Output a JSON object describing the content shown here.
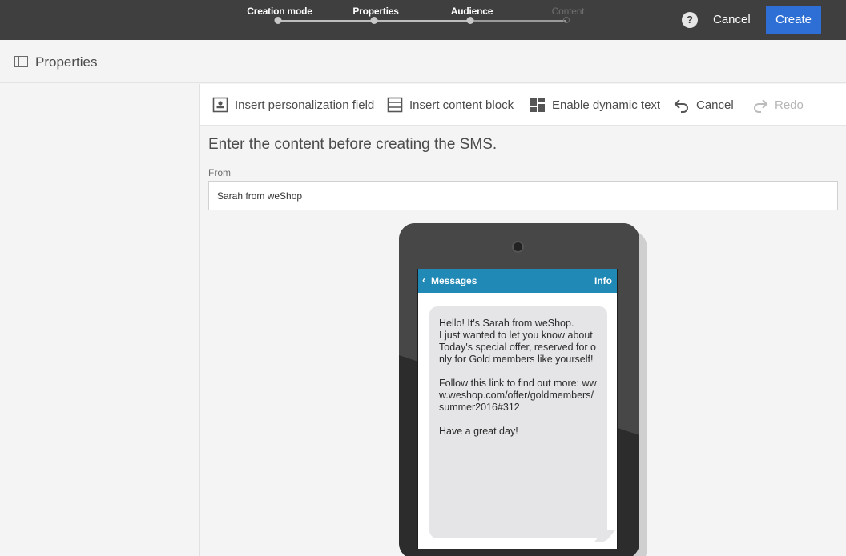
{
  "wizard": {
    "steps": [
      {
        "label": "Creation mode",
        "state": "done"
      },
      {
        "label": "Properties",
        "state": "done"
      },
      {
        "label": "Audience",
        "state": "done"
      },
      {
        "label": "Content",
        "state": "current"
      }
    ],
    "help_icon": "?",
    "cancel_label": "Cancel",
    "create_label": "Create"
  },
  "properties_bar": {
    "icon": "panel-toggle-icon",
    "title": "Properties"
  },
  "toolbar": {
    "personalization_label": "Insert personalization field",
    "content_block_label": "Insert content block",
    "dynamic_text_label": "Enable dynamic text",
    "cancel_label": "Cancel",
    "redo_label": "Redo"
  },
  "form": {
    "instruction": "Enter the content before creating the SMS.",
    "from_label": "From",
    "from_value": "Sarah from weShop"
  },
  "phone": {
    "header_back": "Messages",
    "header_info": "Info",
    "message": "Hello! It's Sarah from weShop.\nI just wanted to let you know about Today's special offer, reserved for only for Gold members like yourself!\n\nFollow this link to find out more: www.weshop.com/offer/goldmembers/summer2016#312\n\nHave a great day!"
  },
  "colors": {
    "topbar": "#3f3f3f",
    "create_button": "#2d6fd4",
    "message_header": "#2089b6",
    "bubble": "#e5e5e7"
  }
}
